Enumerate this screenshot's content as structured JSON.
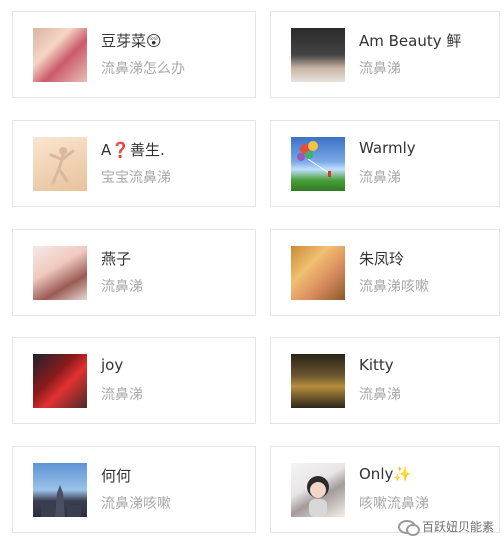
{
  "comments": [
    {
      "name": "豆芽菜😲",
      "text": "流鼻涕怎么办",
      "avatar_icon": "baby-photo-icon"
    },
    {
      "name": "Am Beauty 鲆",
      "text": "流鼻涕",
      "avatar_icon": "woman-photo-icon"
    },
    {
      "name": "A❓善生.",
      "text": "宝宝流鼻涕",
      "avatar_icon": "dancer-figure-icon"
    },
    {
      "name": "Warmly",
      "text": "流鼻涕",
      "avatar_icon": "balloons-landscape-icon"
    },
    {
      "name": "燕子",
      "text": "流鼻涕",
      "avatar_icon": "girl-photo-icon"
    },
    {
      "name": "朱凤玲",
      "text": "流鼻涕咳嗽",
      "avatar_icon": "twin-babies-icon"
    },
    {
      "name": "joy",
      "text": "流鼻涕",
      "avatar_icon": "red-hat-icon"
    },
    {
      "name": "Kitty",
      "text": "流鼻涕",
      "avatar_icon": "hall-interior-icon"
    },
    {
      "name": "何何",
      "text": "流鼻涕咳嗽",
      "avatar_icon": "tower-landscape-icon"
    },
    {
      "name": "Only✨",
      "text": "咳嗽流鼻涕",
      "avatar_icon": "child-photo-icon"
    }
  ],
  "watermark": {
    "text": "百跃妞贝能素",
    "icon": "wechat-icon"
  }
}
